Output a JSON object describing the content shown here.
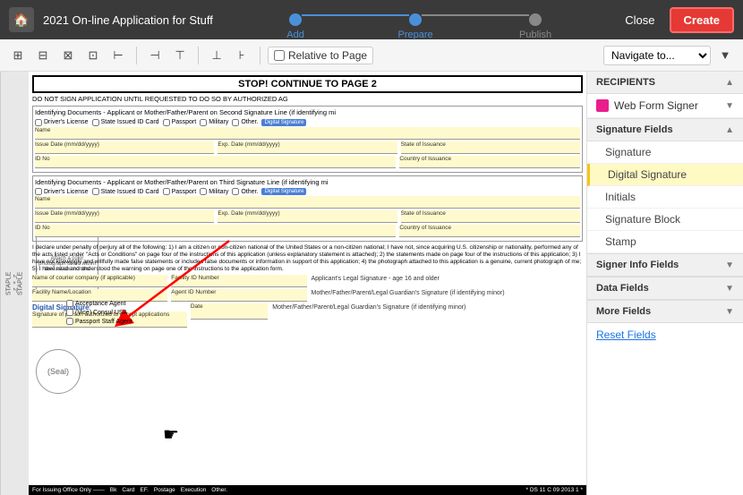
{
  "topbar": {
    "home_icon": "🏠",
    "app_title": "2021 On-line Application for Stuff",
    "steps": [
      {
        "label": "Add",
        "state": "completed"
      },
      {
        "label": "Prepare",
        "state": "active"
      },
      {
        "label": "Publish",
        "state": "inactive"
      }
    ],
    "close_label": "Close",
    "create_label": "Create"
  },
  "toolbar": {
    "relative_label": "Relative to Page",
    "navigate_placeholder": "Navigate to...",
    "icons": [
      "⊞",
      "⊟",
      "⊠",
      "⊡",
      "⊢",
      "⊣",
      "⊤",
      "⊥",
      "⊦",
      "⊧"
    ]
  },
  "document": {
    "stop_text": "STOP! CONTINUE TO PAGE 2",
    "dont_sign": "DO NOT SIGN APPLICATION UNTIL REQUESTED TO DO SO BY AUTHORIZED AG",
    "id_header_1": "Identifying Documents - Applicant or Mother/Father/Parent on Second Signature Line (if identifying mi",
    "id_header_2": "Identifying Documents - Applicant or Mother/Father/Parent on Third Signature Line (if identifying mi",
    "checkboxes": [
      "Driver's License",
      "State Issued ID Card",
      "Passport",
      "Military",
      "Other.",
      "Digital Signature"
    ],
    "fields": {
      "name": "Name",
      "issue_date": "Issue Date (mm/dd/yyyy)",
      "exp_date": "Exp. Date (mm/dd/yyyy)",
      "state_of_issuance": "State of Issuance",
      "id_no": "ID No",
      "country_of_issuance": "Country of Issuance"
    },
    "declaration": "I declare under penalty of perjury all of the following: 1) I am a citizen or non-citizen national of the United States or a non-citizen national; I have not, since acquiring U.S. citizenship or nationality, performed any of the acts listed under \"Acts or Conditions\" on page four of the instructions of this application (unless explanatory statement is attached); 2) the statements made on page four of the instructions of this application; 3) I have not knowingly and willfully made false statements or included false documents or information in support of this application; 4) the photograph attached to this application is a genuine, current photograph of me; 5) I have read and understood the warning on page one of the instructions to the application form.",
    "sig_labels": {
      "legal_sig": "Applicant's Legal Signature - age 16 and older",
      "mother_sig": "Mother/Father/Parent/Legal Guardian's Signature (if identifying minor)",
      "mother_sig2": "Mother/Father/Parent/Legal Guardian's Signature (if identifying minor)"
    },
    "bottom_fields": [
      "For Issuing Office Only ——",
      "Bk",
      "Card",
      "EF.",
      "Postage",
      "Execution",
      "Other."
    ],
    "barcode_text": "* DS 11 C 09 2013 1 *",
    "digital_sig_label": "Digital Signature",
    "sig_authorized_label": "Signature of person authorized to accept applications",
    "date_label": "Date",
    "name_courier": "Name of courier company (if applicable)",
    "facility_id": "Facility ID Number",
    "facility_name": "Facility Name/Location",
    "agent_id": "Agent ID Number",
    "acceptance_agent": "Acceptance Agent",
    "vice_consul": "(Vice) Consul USA",
    "passport_staff": "Passport Staff Agent",
    "staple_text": "STAPLE",
    "dimensions": "2\" × 2\"",
    "from1_text": "FROM 1\" TO 1 3/8\"",
    "photo_caption": "Attach a color photograph taken within the last six months",
    "seal_label": "(Seal)"
  },
  "right_panel": {
    "recipients_label": "RECIPIENTS",
    "recipient": {
      "name": "Web Form Signer",
      "color": "#e91e8c"
    },
    "signature_fields_label": "Signature Fields",
    "fields": [
      {
        "label": "Signature",
        "active": false
      },
      {
        "label": "Digital Signature",
        "active": true
      },
      {
        "label": "Initials",
        "active": false
      },
      {
        "label": "Signature Block",
        "active": false
      },
      {
        "label": "Stamp",
        "active": false
      }
    ],
    "signer_info_label": "Signer Info Fields",
    "data_fields_label": "Data Fields",
    "more_fields_label": "More Fields",
    "reset_label": "Reset Fields"
  }
}
